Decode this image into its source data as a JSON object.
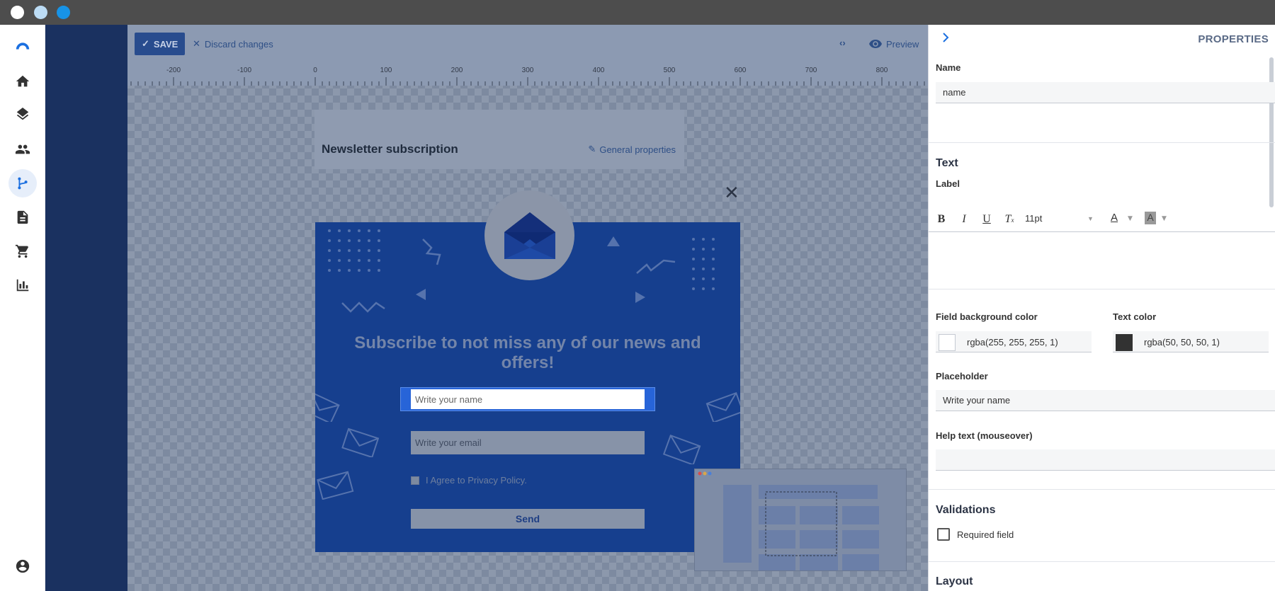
{
  "toolbar": {
    "save_label": "SAVE",
    "discard_label": "Discard changes",
    "code_icon": "code-icon",
    "preview_label": "Preview"
  },
  "ruler": {
    "ticks": [
      "-200",
      "-100",
      "0",
      "100",
      "200",
      "300",
      "400",
      "500",
      "600",
      "700",
      "800"
    ]
  },
  "form": {
    "title": "Newsletter subscription",
    "general_properties_label": "General properties",
    "popup": {
      "heading": "Subscribe to not miss any of our news and offers!",
      "name_placeholder": "Write your name",
      "email_placeholder": "Write your email",
      "privacy_label": "I Agree to Privacy Policy.",
      "send_label": "Send"
    }
  },
  "properties": {
    "title": "PROPERTIES",
    "name_label": "Name",
    "name_value": "name",
    "text_section": "Text",
    "label_label": "Label",
    "font_size": "11pt",
    "field_bg_label": "Field background color",
    "field_bg_value": "rgba(255, 255, 255, 1)",
    "text_color_label": "Text color",
    "text_color_value": "rgba(50, 50, 50, 1)",
    "placeholder_label": "Placeholder",
    "placeholder_value": "Write your name",
    "help_label": "Help text (mouseover)",
    "help_value": "",
    "validations_section": "Validations",
    "required_label": "Required field",
    "layout_section": "Layout"
  },
  "colors": {
    "accent": "#2764d8",
    "nav_dark": "#1a3160",
    "popup_bg": "#163f8e",
    "titlebar_dot_1": "#ffffff",
    "titlebar_dot_2": "#bcdcf5",
    "titlebar_dot_3": "#1793e6"
  }
}
